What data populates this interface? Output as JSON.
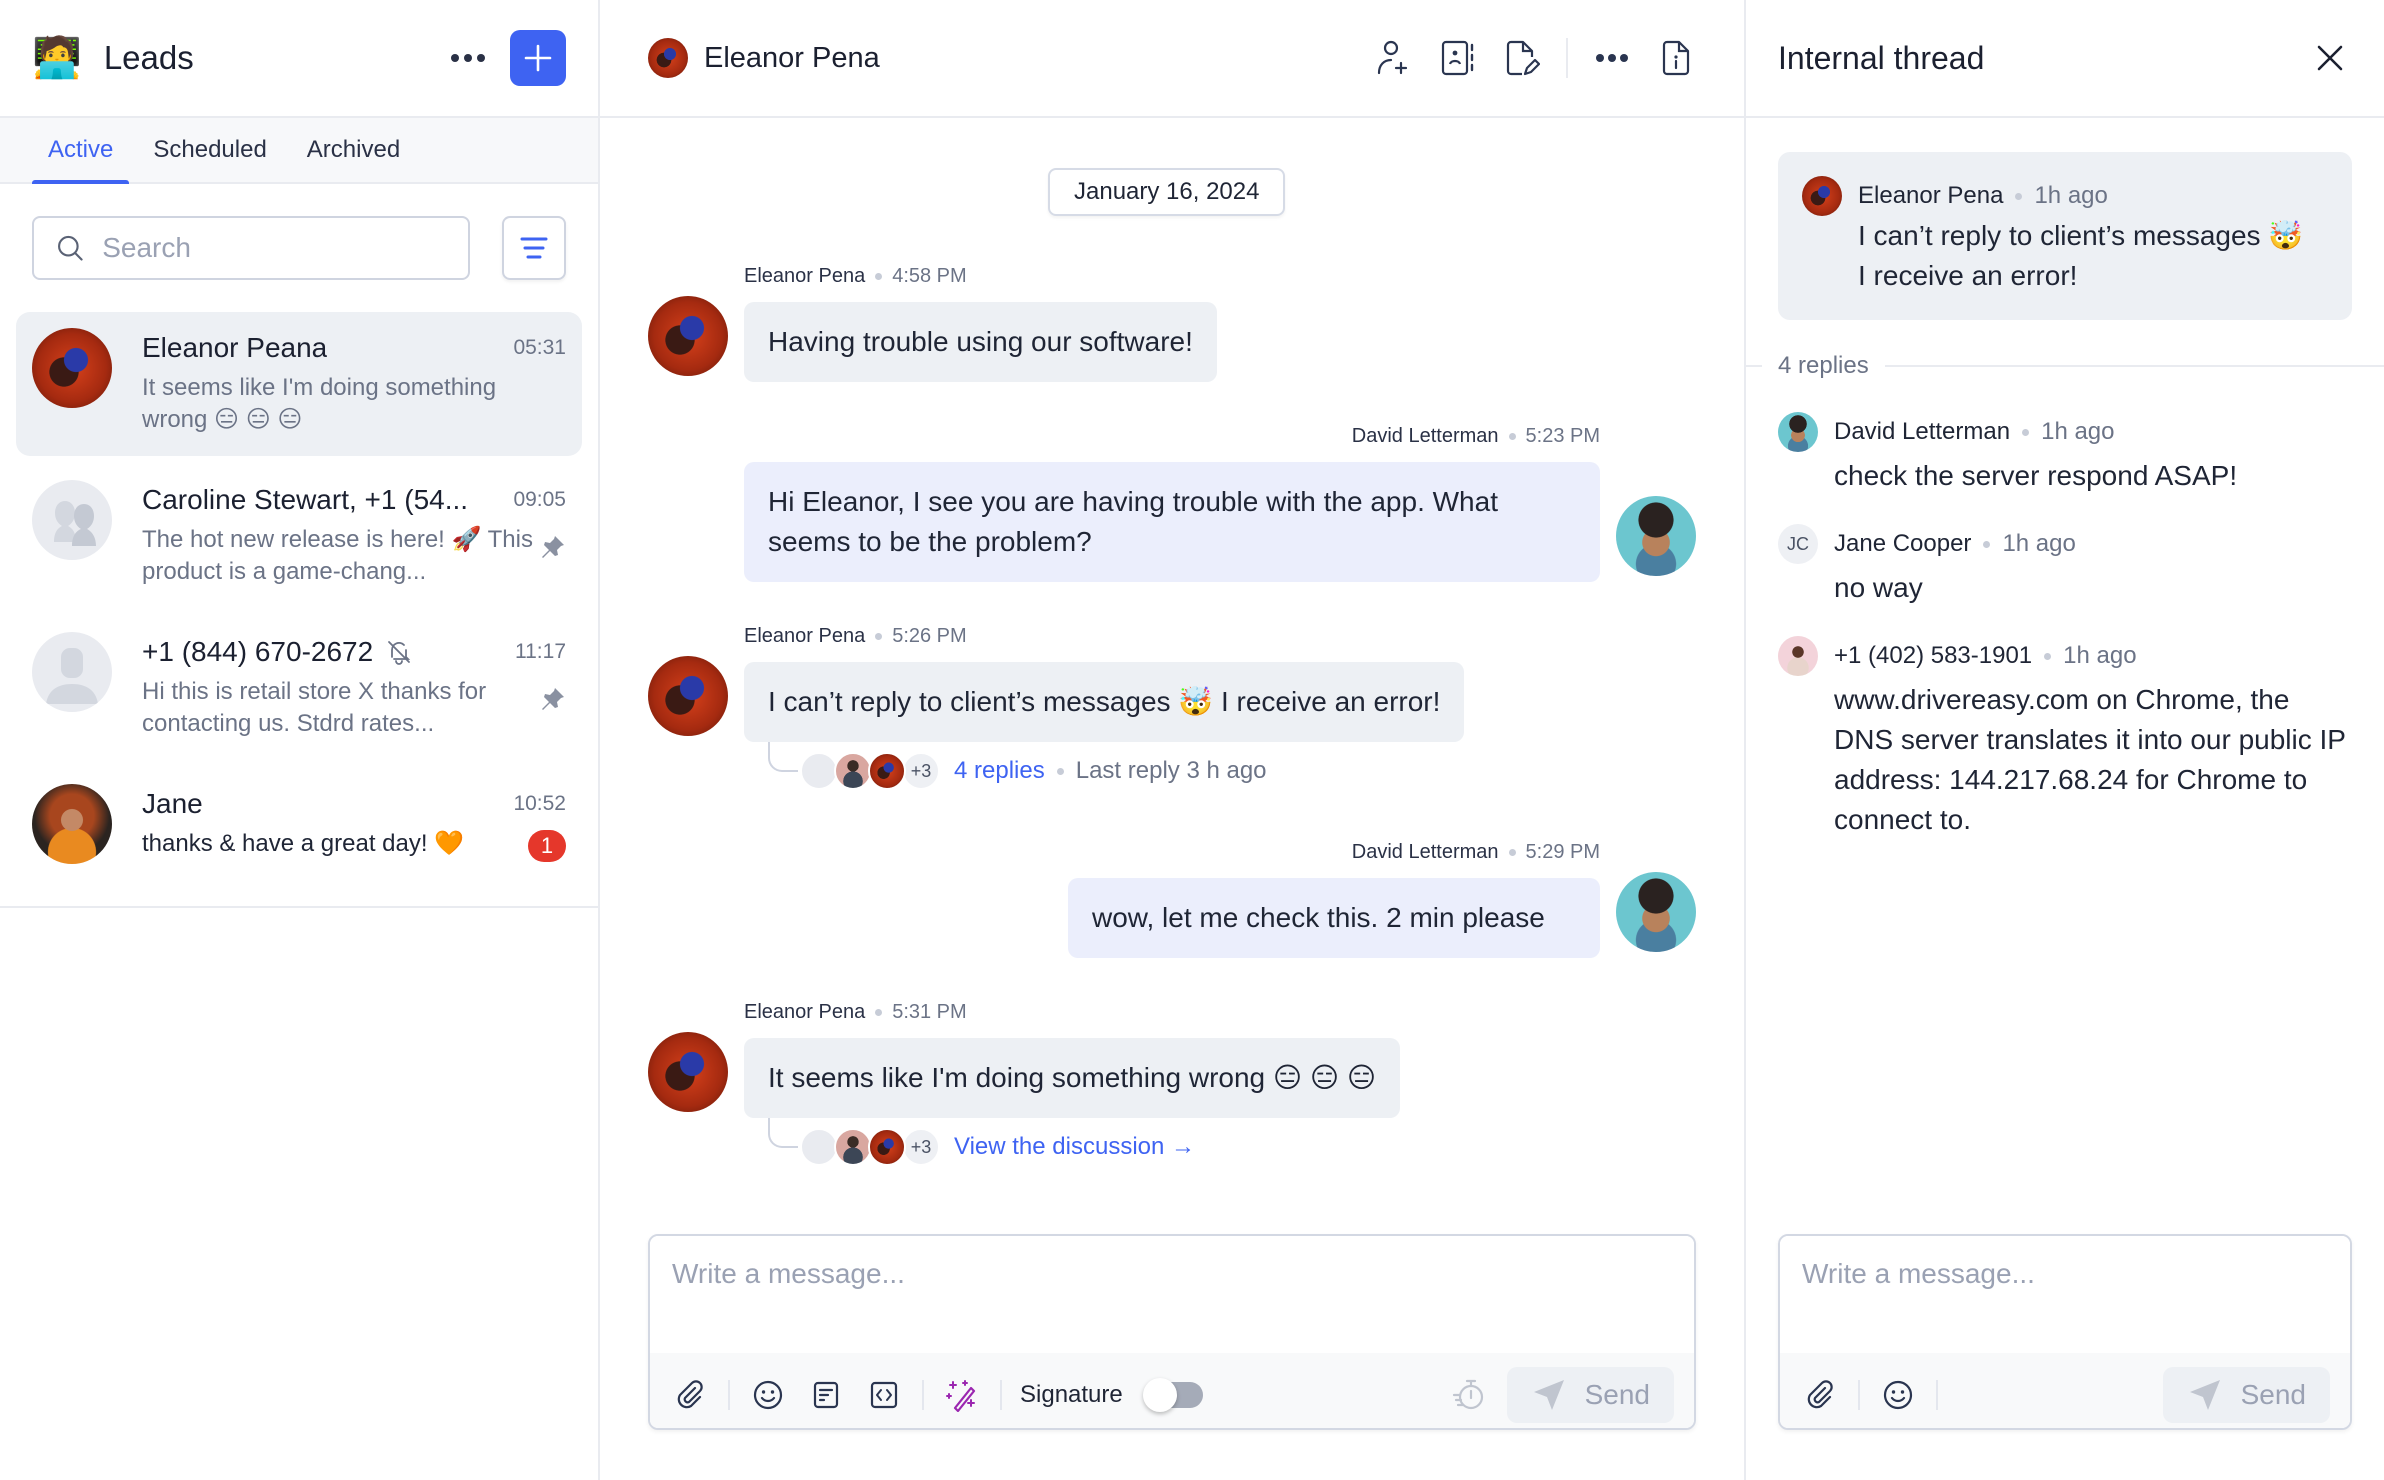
{
  "sidebar": {
    "emoji": "🧑‍💻",
    "title": "Leads",
    "tabs": [
      {
        "label": "Active",
        "active": true
      },
      {
        "label": "Scheduled",
        "active": false
      },
      {
        "label": "Archived",
        "active": false
      }
    ],
    "search": {
      "placeholder": "Search",
      "value": ""
    },
    "conversations": [
      {
        "name": "Eleanor Peana",
        "time": "05:31",
        "preview": "It seems like I'm doing something wrong 😑 😑 😑",
        "selected": true,
        "avatar": "eleanor-photo"
      },
      {
        "name": "Caroline Stewart, +1 (54...",
        "time": "09:05",
        "preview": "The hot new release is here! 🚀 This product is a game-chang...",
        "pinned": true,
        "avatar": "group-placeholder"
      },
      {
        "name": "+1 (844) 670-2672",
        "time": "11:17",
        "preview": "Hi this is retail store X thanks for contacting us. Stdrd rates...",
        "pinned": true,
        "muted": true,
        "avatar": "person-placeholder"
      },
      {
        "name": "Jane",
        "time": "10:52",
        "preview": "thanks & have a great day! 🧡",
        "unread": "1",
        "avatar": "jane-photo"
      }
    ]
  },
  "chat": {
    "contact_name": "Eleanor Pena",
    "header_icons": [
      "add-contact-icon",
      "contact-book-icon",
      "edit-note-icon",
      "more-icon",
      "file-info-icon"
    ],
    "date_label": "January 16, 2024",
    "messages": [
      {
        "sender": "Eleanor Pena",
        "time": "4:58 PM",
        "text": "Having trouble using our software!",
        "direction": "in"
      },
      {
        "sender": "David Letterman",
        "time": "5:23 PM",
        "text": "Hi Eleanor, I see you are having trouble with the app. What seems to be the problem?",
        "direction": "out"
      },
      {
        "sender": "Eleanor Pena",
        "time": "5:26 PM",
        "text": "I can’t reply to client’s messages 🤯 I receive an error!",
        "direction": "in",
        "thread": {
          "more_count": "+3",
          "replies_label": "4 replies",
          "last_reply": "Last reply 3 h ago"
        }
      },
      {
        "sender": "David Letterman",
        "time": "5:29 PM",
        "text": "wow, let me check this. 2 min please",
        "direction": "out"
      },
      {
        "sender": "Eleanor Pena",
        "time": "5:31 PM",
        "text": "It seems like I'm doing something wrong 😑 😑 😑",
        "direction": "in",
        "thread": {
          "more_count": "+3",
          "link_label": "View the discussion →"
        }
      }
    ],
    "composer": {
      "placeholder": "Write a message...",
      "signature_label": "Signature",
      "signature_on": false,
      "send_label": "Send"
    }
  },
  "thread_panel": {
    "title": "Internal thread",
    "root": {
      "sender": "Eleanor Pena",
      "time": "1h ago",
      "text_line1": "I can’t reply to client’s messages 🤯",
      "text_line2": "I receive an error!"
    },
    "replies_count_label": "4 replies",
    "replies": [
      {
        "sender": "David Letterman",
        "time": "1h ago",
        "text": "check the server respond ASAP!",
        "avatar": "david-photo"
      },
      {
        "sender": "Jane Cooper",
        "time": "1h ago",
        "text": "no way",
        "initials": "JC"
      },
      {
        "sender": "+1 (402) 583-1901",
        "time": "1h ago",
        "text": "www.drivereasy.com on Chrome, the DNS server translates it into our public IP address: 144.217.68.24 for Chrome to connect to.",
        "avatar": "pink-photo"
      }
    ],
    "composer": {
      "placeholder": "Write a message...",
      "send_label": "Send"
    }
  },
  "colors": {
    "accent": "#3e63f2",
    "badge": "#e5372b",
    "incoming_bubble": "#edf0f4",
    "outgoing_bubble": "#ebeefc",
    "magic": "#9b27b0"
  }
}
